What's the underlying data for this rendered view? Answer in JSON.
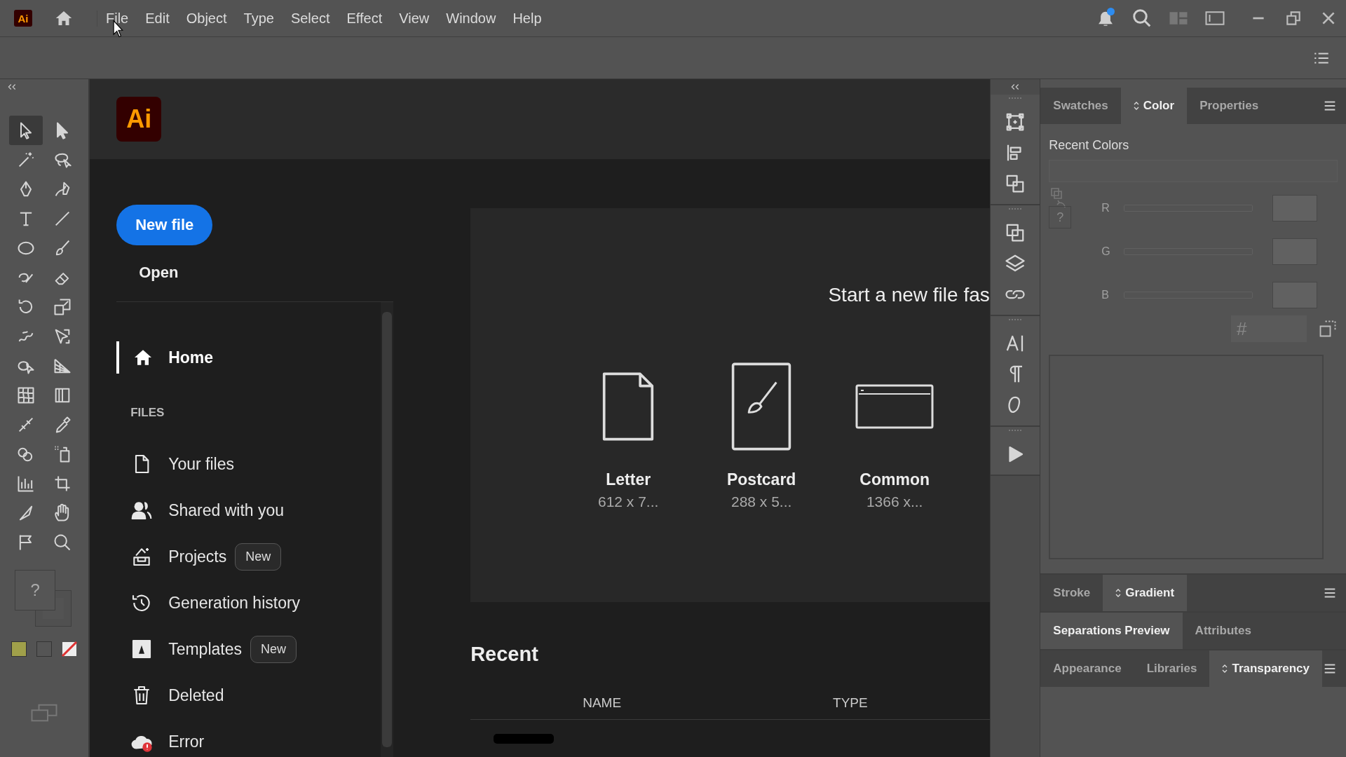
{
  "app_logo": "Ai",
  "menu": [
    "File",
    "Edit",
    "Object",
    "Type",
    "Select",
    "Effect",
    "View",
    "Window",
    "Help"
  ],
  "notifications": {
    "unread": true
  },
  "tools": [
    {
      "kind": "selection",
      "selected": true
    },
    {
      "kind": "direct_selection",
      "selected": false
    },
    {
      "kind": "magic_wand",
      "selected": false
    },
    {
      "kind": "lasso",
      "selected": false
    },
    {
      "kind": "pen",
      "selected": false
    },
    {
      "kind": "curvature",
      "selected": false
    },
    {
      "kind": "type",
      "selected": false
    },
    {
      "kind": "line",
      "selected": false
    },
    {
      "kind": "ellipse",
      "selected": false
    },
    {
      "kind": "paintbrush",
      "selected": false
    },
    {
      "kind": "blob_brush",
      "selected": false
    },
    {
      "kind": "eraser",
      "selected": false
    },
    {
      "kind": "rotate",
      "selected": false
    },
    {
      "kind": "scale",
      "selected": false
    },
    {
      "kind": "warp",
      "selected": false
    },
    {
      "kind": "free_transform",
      "selected": false
    },
    {
      "kind": "shape_builder",
      "selected": false
    },
    {
      "kind": "perspective",
      "selected": false
    },
    {
      "kind": "mesh",
      "selected": false
    },
    {
      "kind": "gradient",
      "selected": false
    },
    {
      "kind": "width",
      "selected": false
    },
    {
      "kind": "eyedropper",
      "selected": false
    },
    {
      "kind": "blend",
      "selected": false
    },
    {
      "kind": "symbol_sprayer",
      "selected": false
    },
    {
      "kind": "graph",
      "selected": false
    },
    {
      "kind": "artboard",
      "selected": false
    },
    {
      "kind": "knife",
      "selected": false
    },
    {
      "kind": "hand",
      "selected": false
    },
    {
      "kind": "puppet",
      "selected": false
    },
    {
      "kind": "zoom",
      "selected": false
    }
  ],
  "fill_stroke": {
    "fill_mark": "?"
  },
  "home": {
    "logo": "Ai",
    "new_file": "New file",
    "open": "Open",
    "nav": [
      {
        "kind": "home",
        "label": "Home",
        "selected": true
      }
    ],
    "files_heading": "FILES",
    "files": [
      {
        "kind": "file",
        "label": "Your files",
        "selected": false
      },
      {
        "kind": "shared",
        "label": "Shared with you",
        "selected": false
      },
      {
        "kind": "projects",
        "label": "Projects",
        "badge": "New",
        "selected": false
      },
      {
        "kind": "history",
        "label": "Generation history",
        "selected": false
      },
      {
        "kind": "templates",
        "label": "Templates",
        "badge": "New",
        "selected": false
      },
      {
        "kind": "trash",
        "label": "Deleted",
        "selected": false
      },
      {
        "kind": "error",
        "label": "Error",
        "selected": false
      }
    ],
    "start_heading": "Start a new file fas",
    "presets": [
      {
        "kind": "letter",
        "name": "Letter",
        "size": "612 x 7..."
      },
      {
        "kind": "postcard",
        "name": "Postcard",
        "size": "288 x 5..."
      },
      {
        "kind": "common",
        "name": "Common",
        "size": "1366 x..."
      }
    ],
    "recent_heading": "Recent",
    "columns": [
      "NAME",
      "TYPE"
    ]
  },
  "panel_groups": [
    {
      "kind": "color",
      "menu": true,
      "tabs": [
        {
          "label": "Swatches",
          "selected": false
        },
        {
          "label": "Color",
          "selected": true
        },
        {
          "label": "Properties",
          "selected": false
        }
      ]
    },
    {
      "kind": "empty",
      "menu": true,
      "tabs": [
        {
          "label": "Stroke",
          "selected": false
        },
        {
          "label": "Gradient",
          "selected": true
        }
      ]
    },
    {
      "kind": "empty",
      "menu": false,
      "tabs": [
        {
          "label": "Separations Preview",
          "selected": true
        },
        {
          "label": "Attributes",
          "selected": false
        }
      ]
    },
    {
      "kind": "fill",
      "menu": true,
      "tabs": [
        {
          "label": "Appearance",
          "selected": false
        },
        {
          "label": "Libraries",
          "selected": false
        },
        {
          "label": "Transparency",
          "selected": true
        }
      ]
    }
  ],
  "color_panel": {
    "recent_label": "Recent Colors",
    "fill_mark": "?",
    "channels": [
      "R",
      "G",
      "B"
    ],
    "hex_label": "#"
  }
}
